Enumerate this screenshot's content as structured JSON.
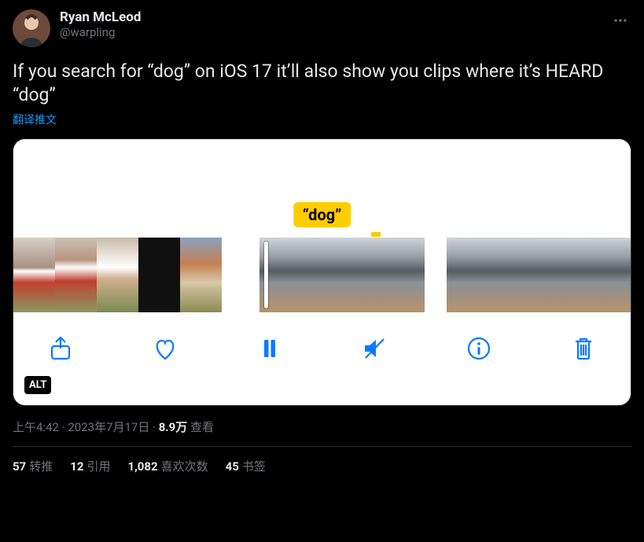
{
  "author": {
    "display_name": "Ryan McLeod",
    "handle": "@warpling"
  },
  "tweet_text": "If you search for “dog” on iOS 17 it’ll also show you clips where it’s HEARD “dog”",
  "translate_label": "翻译推文",
  "media": {
    "search_label": "“dog”",
    "alt_badge": "ALT"
  },
  "meta": {
    "time": "上午4:42",
    "sep1": " · ",
    "date": "2023年7月17日",
    "sep2": " · ",
    "views_count": "8.9万",
    "views_label": " 查看"
  },
  "stats": {
    "retweets": {
      "count": "57",
      "label": "转推"
    },
    "quotes": {
      "count": "12",
      "label": "引用"
    },
    "likes": {
      "count": "1,082",
      "label": "喜欢次数"
    },
    "bookmarks": {
      "count": "45",
      "label": "书签"
    }
  }
}
